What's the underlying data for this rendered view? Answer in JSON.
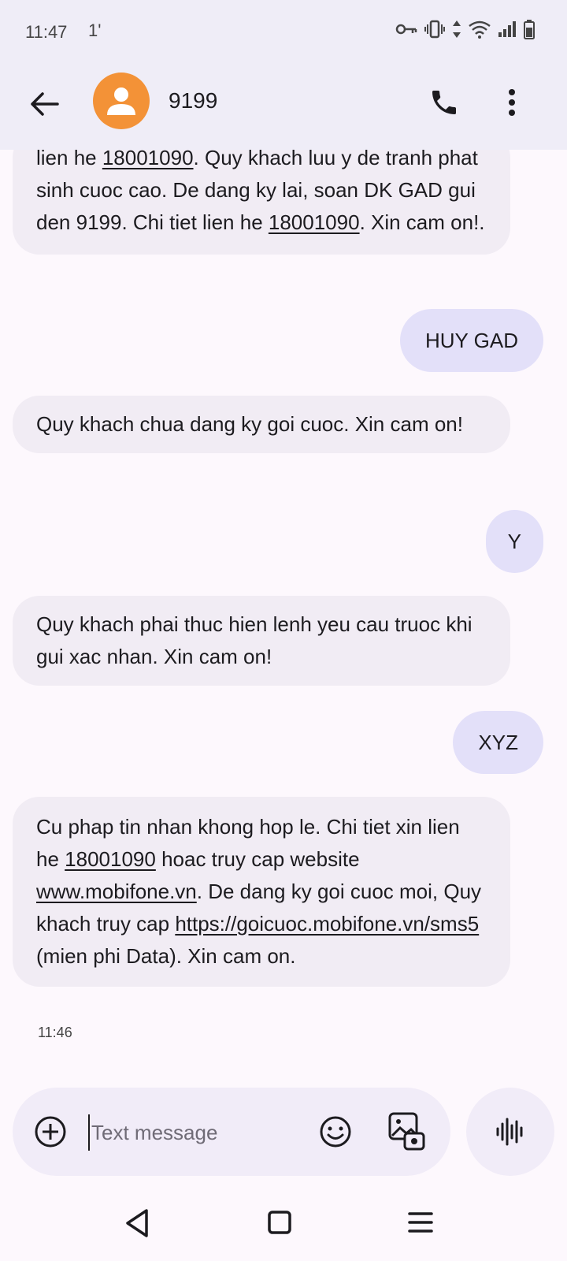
{
  "status": {
    "time": "11:47",
    "extra": "1'"
  },
  "header": {
    "contact_name": "9199",
    "icons": [
      "back-arrow-icon",
      "avatar-person-icon",
      "phone-icon",
      "more-vert-icon"
    ]
  },
  "messages": [
    {
      "direction": "in",
      "segments": [
        {
          "text": "lien he "
        },
        {
          "text": "18001090",
          "link": true
        },
        {
          "text": ". Quy khach luu y de tranh phat sinh cuoc cao. De dang ky lai, soan DK GAD gui den 9199. Chi tiet lien he "
        },
        {
          "text": "18001090",
          "link": true
        },
        {
          "text": ". Xin cam on!."
        }
      ]
    },
    {
      "direction": "out",
      "text": "HUY GAD"
    },
    {
      "direction": "in",
      "segments": [
        {
          "text": "Quy khach chua dang ky goi cuoc. Xin cam on!"
        }
      ]
    },
    {
      "direction": "out",
      "text": "Y"
    },
    {
      "direction": "in",
      "segments": [
        {
          "text": "Quy khach phai thuc hien lenh yeu cau truoc khi gui xac nhan. Xin cam on!"
        }
      ]
    },
    {
      "direction": "out",
      "text": "XYZ"
    },
    {
      "direction": "in",
      "segments": [
        {
          "text": "Cu phap tin nhan khong hop le. Chi tiet xin lien he "
        },
        {
          "text": "18001090",
          "link": true
        },
        {
          "text": " hoac truy cap website "
        },
        {
          "text": "www.mobifone.vn",
          "link": true
        },
        {
          "text": ". De dang ky goi cuoc moi, Quy khach truy cap "
        },
        {
          "text": "https://goicuoc.mobifone.vn/sms5",
          "link": true
        },
        {
          "text": " (mien phi Data). Xin cam on."
        }
      ]
    }
  ],
  "last_timestamp": "11:46",
  "compose": {
    "placeholder": "Text message",
    "value": ""
  },
  "colors": {
    "header_bg": "#efedf7",
    "avatar": "#f39237",
    "incoming_bubble": "#f1ecf4",
    "outgoing_bubble": "#e3e0f9"
  }
}
